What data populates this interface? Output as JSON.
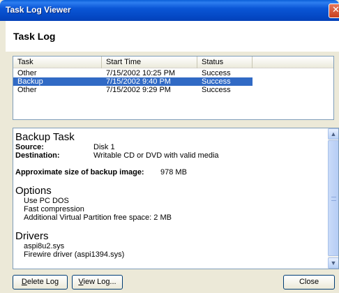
{
  "window": {
    "title": "Task Log Viewer",
    "close_glyph": "✕"
  },
  "header": {
    "title": "Task Log"
  },
  "list": {
    "columns": [
      "Task",
      "Start Time",
      "Status"
    ],
    "rows": [
      {
        "task": "Other",
        "start": "7/15/2002 10:25 PM",
        "status": "Success",
        "selected": false
      },
      {
        "task": "Backup",
        "start": "7/15/2002 9:40 PM",
        "status": "Success",
        "selected": true
      },
      {
        "task": "Other",
        "start": "7/15/2002 9:29 PM",
        "status": "Success",
        "selected": false
      }
    ]
  },
  "details": {
    "title": "Backup Task",
    "source_label": "Source:",
    "source_value": "Disk 1",
    "destination_label": "Destination:",
    "destination_value": "Writable CD or DVD with valid media",
    "size_label": "Approximate size of backup image:",
    "size_value": "978 MB",
    "options_title": "Options",
    "options": [
      "Use PC DOS",
      "Fast compression",
      "Additional Virtual Partition free space: 2 MB"
    ],
    "drivers_title": "Drivers",
    "drivers": [
      "aspi8u2.sys",
      "Firewire driver (aspi1394.sys)"
    ]
  },
  "buttons": {
    "delete_first": "D",
    "delete_rest": "elete Log",
    "view_first": "V",
    "view_rest": "iew Log...",
    "close": "Close"
  },
  "colors": {
    "title_bar": "#0a56d6",
    "selection": "#316ac5",
    "face": "#ece9d8"
  }
}
